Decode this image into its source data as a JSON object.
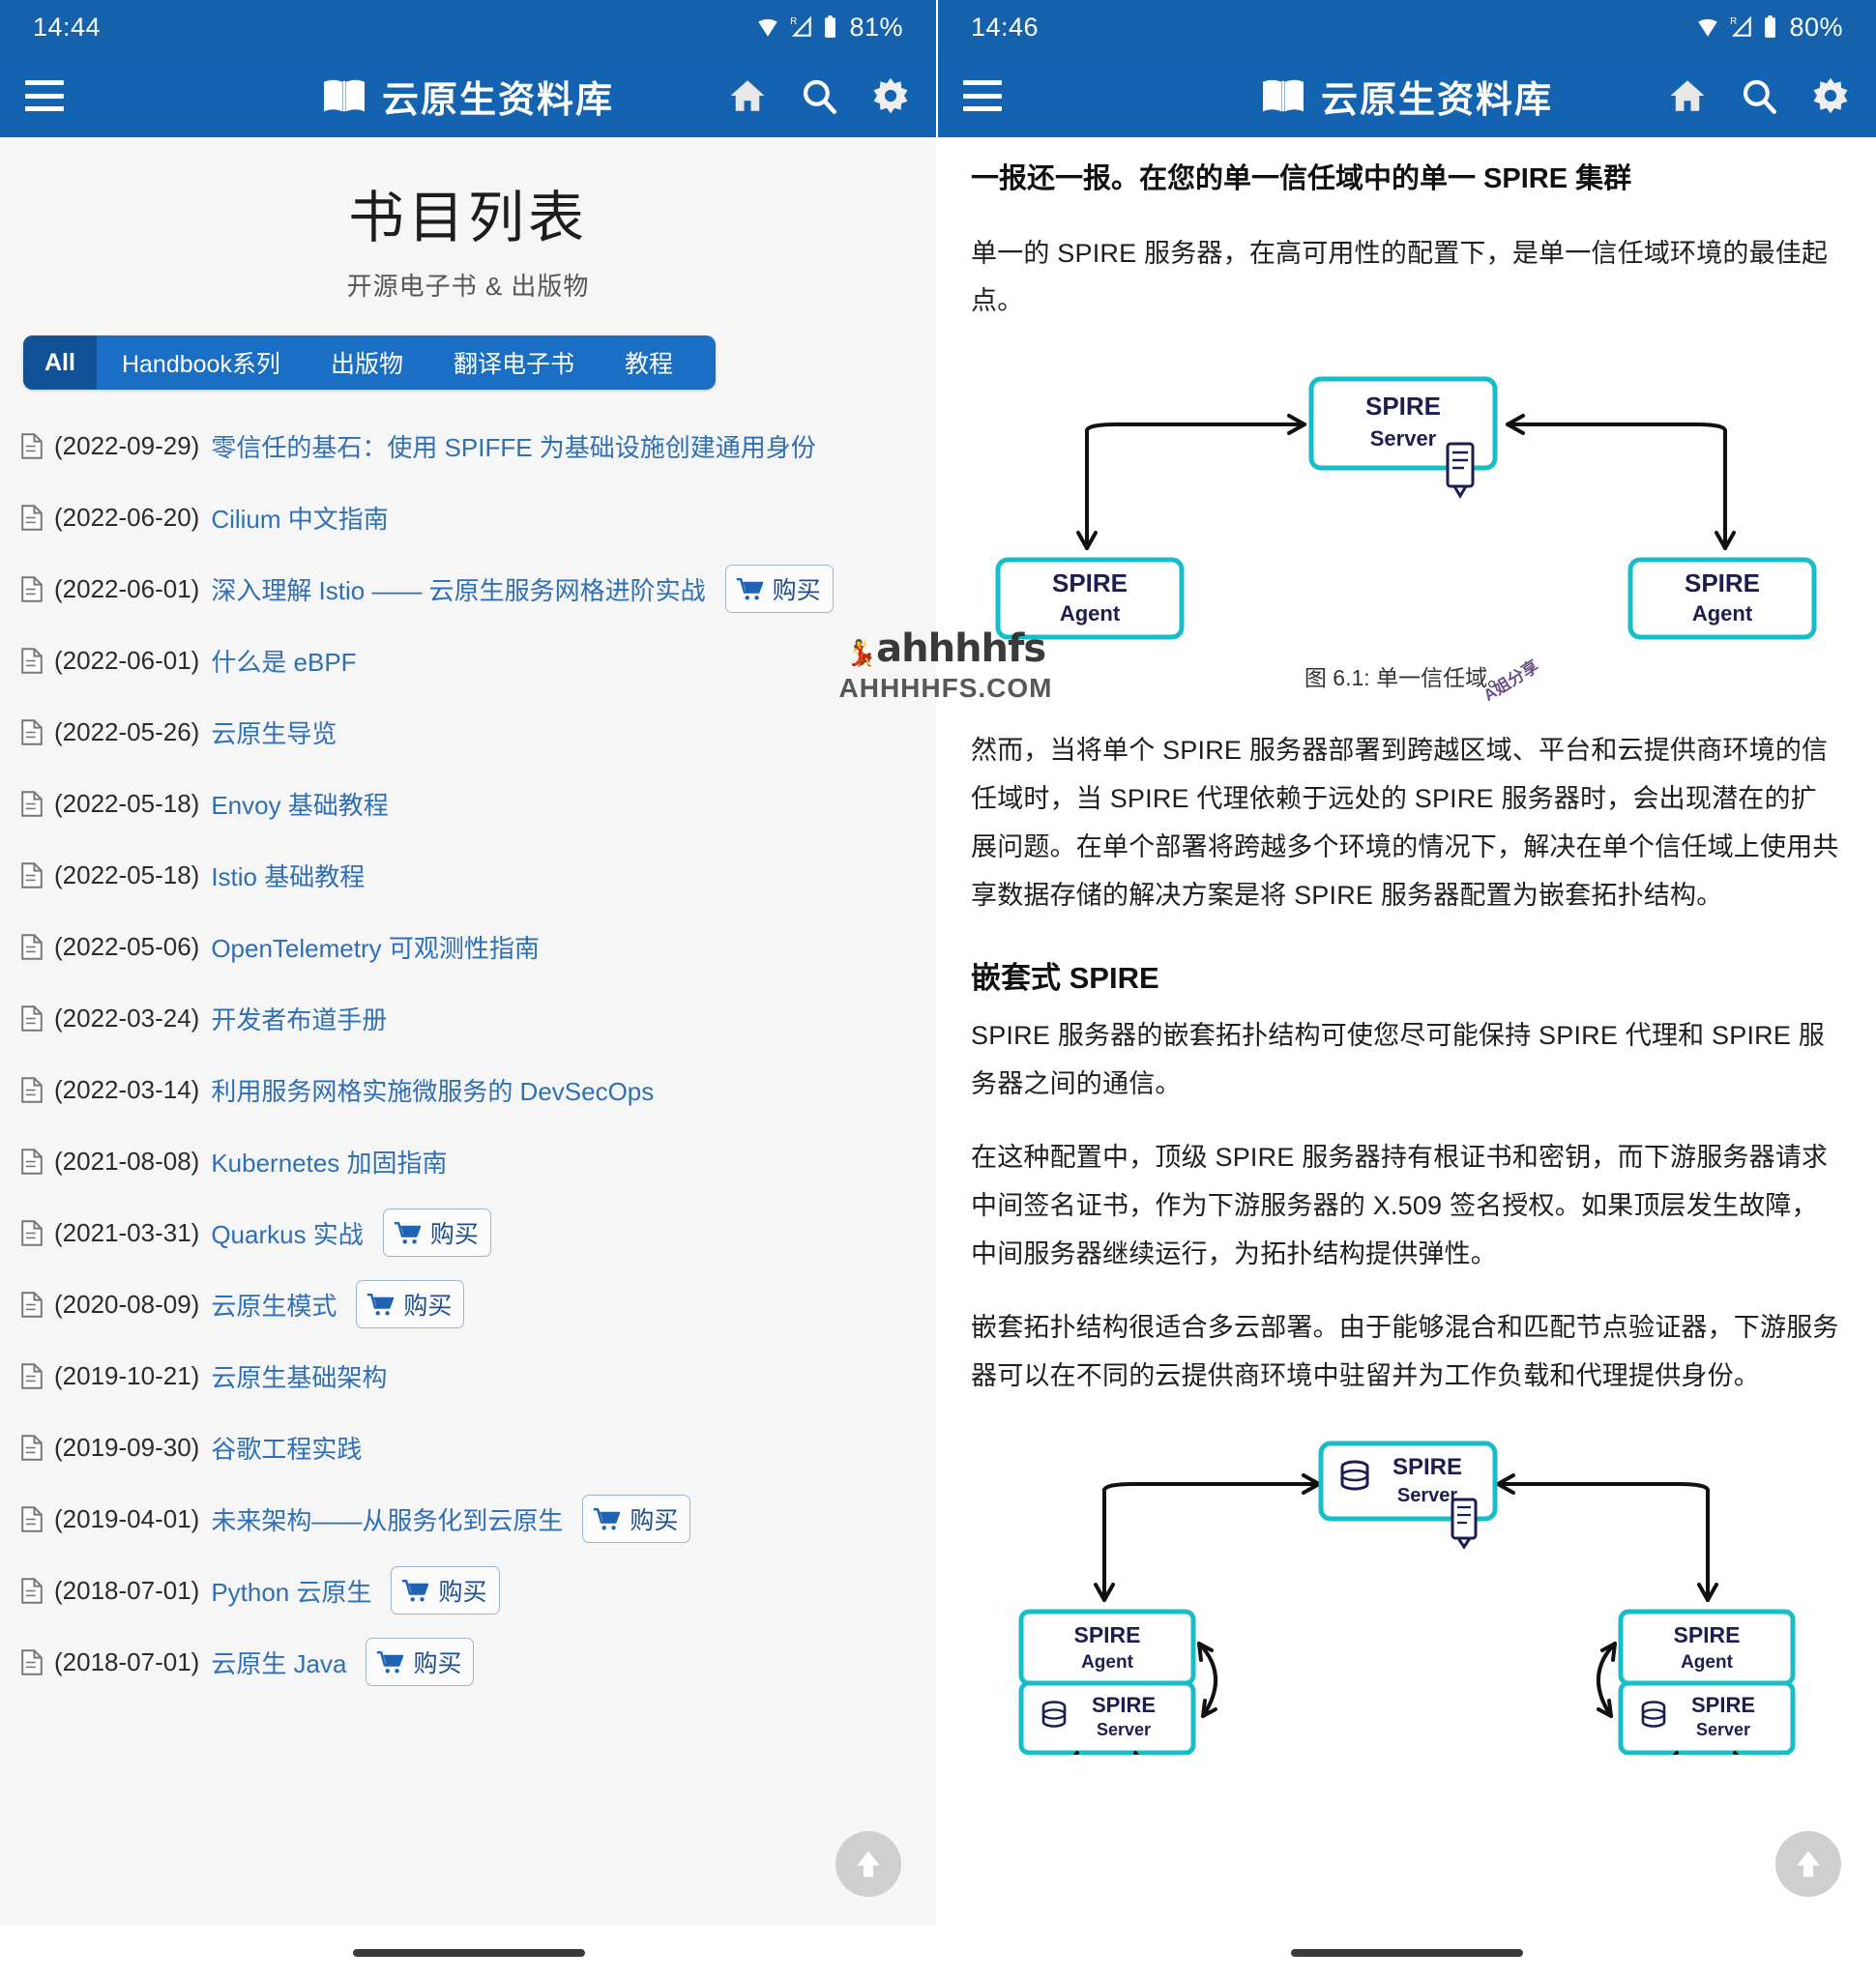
{
  "left_screen": {
    "statusbar": {
      "time": "14:44",
      "battery": "81%",
      "wifi_icon": "wifi-icon",
      "signal_icon": "signal-roaming-icon",
      "battery_icon": "battery-icon"
    },
    "appbar": {
      "menu_icon": "hamburger-menu-icon",
      "logo_icon": "open-book-icon",
      "title": "云原生资料库",
      "actions": [
        {
          "name": "home-icon",
          "label": "首页"
        },
        {
          "name": "search-icon",
          "label": "搜索"
        },
        {
          "name": "gear-icon",
          "label": "设置"
        }
      ]
    },
    "page": {
      "title": "书目列表",
      "subtitle": "开源电子书 & 出版物",
      "tabs": [
        {
          "label": "All",
          "active": true
        },
        {
          "label": "Handbook系列",
          "active": false
        },
        {
          "label": "出版物",
          "active": false
        },
        {
          "label": "翻译电子书",
          "active": false
        },
        {
          "label": "教程",
          "active": false
        }
      ],
      "buy_label": "购买",
      "books": [
        {
          "date": "(2022-09-29)",
          "name": "零信任的基石：使用 SPIFFE 为基础设施创建通用身份",
          "buy": false
        },
        {
          "date": "(2022-06-20)",
          "name": "Cilium 中文指南",
          "buy": false
        },
        {
          "date": "(2022-06-01)",
          "name": "深入理解 Istio —— 云原生服务网格进阶实战",
          "buy": true
        },
        {
          "date": "(2022-06-01)",
          "name": "什么是 eBPF",
          "buy": false
        },
        {
          "date": "(2022-05-26)",
          "name": "云原生导览",
          "buy": false
        },
        {
          "date": "(2022-05-18)",
          "name": "Envoy 基础教程",
          "buy": false
        },
        {
          "date": "(2022-05-18)",
          "name": "Istio 基础教程",
          "buy": false
        },
        {
          "date": "(2022-05-06)",
          "name": "OpenTelemetry 可观测性指南",
          "buy": false
        },
        {
          "date": "(2022-03-24)",
          "name": "开发者布道手册",
          "buy": false
        },
        {
          "date": "(2022-03-14)",
          "name": "利用服务网格实施微服务的 DevSecOps",
          "buy": false
        },
        {
          "date": "(2021-08-08)",
          "name": "Kubernetes 加固指南",
          "buy": false
        },
        {
          "date": "(2021-03-31)",
          "name": "Quarkus 实战",
          "buy": true
        },
        {
          "date": "(2020-08-09)",
          "name": "云原生模式",
          "buy": true
        },
        {
          "date": "(2019-10-21)",
          "name": "云原生基础架构",
          "buy": false
        },
        {
          "date": "(2019-09-30)",
          "name": "谷歌工程实践",
          "buy": false
        },
        {
          "date": "(2019-04-01)",
          "name": "未来架构——从服务化到云原生",
          "buy": true
        },
        {
          "date": "(2018-07-01)",
          "name": "Python 云原生",
          "buy": true
        },
        {
          "date": "(2018-07-01)",
          "name": "云原生 Java",
          "buy": true
        }
      ]
    },
    "fab": {
      "name": "scroll-to-top-button",
      "icon": "arrow-up-icon"
    }
  },
  "right_screen": {
    "statusbar": {
      "time": "14:46",
      "battery": "80%",
      "wifi_icon": "wifi-icon",
      "signal_icon": "signal-roaming-icon",
      "battery_icon": "battery-icon"
    },
    "appbar": {
      "menu_icon": "hamburger-menu-icon",
      "logo_icon": "open-book-icon",
      "title": "云原生资料库",
      "actions": [
        {
          "name": "home-icon",
          "label": "首页"
        },
        {
          "name": "search-icon",
          "label": "搜索"
        },
        {
          "name": "gear-icon",
          "label": "设置"
        }
      ]
    },
    "content": {
      "heading": "一报还一报。在您的单一信任域中的单一 SPIRE 集群",
      "para1": "单一的 SPIRE 服务器，在高可用性的配置下，是单一信任域环境的最佳起点。",
      "figure1_caption": "图 6.1: 单一信任域。",
      "para2": "然而，当将单个 SPIRE 服务器部署到跨越区域、平台和云提供商环境的信任域时，当 SPIRE 代理依赖于远处的 SPIRE 服务器时，会出现潜在的扩展问题。在单个部署将跨越多个环境的情况下，解决在单个信任域上使用共享数据存储的解决方案是将 SPIRE 服务器配置为嵌套拓扑结构。",
      "heading2": "嵌套式 SPIRE",
      "para3": "SPIRE 服务器的嵌套拓扑结构可使您尽可能保持 SPIRE 代理和 SPIRE 服务器之间的通信。",
      "para4": "在这种配置中，顶级 SPIRE 服务器持有根证书和密钥，而下游服务器请求中间签名证书，作为下游服务器的 X.509 签名授权。如果顶层发生故障，中间服务器继续运行，为拓扑结构提供弹性。",
      "para5": "嵌套拓扑结构很适合多云部署。由于能够混合和匹配节点验证器，下游服务器可以在不同的云提供商环境中驻留并为工作负载和代理提供身份。"
    },
    "diagram1": {
      "nodes": [
        {
          "title": "SPIRE",
          "subtitle": "Server",
          "has_db_icon": false,
          "has_cert_icon": true
        },
        {
          "title": "SPIRE",
          "subtitle": "Agent",
          "has_db_icon": false,
          "has_cert_icon": false
        },
        {
          "title": "SPIRE",
          "subtitle": "Agent",
          "has_db_icon": false,
          "has_cert_icon": false
        }
      ]
    },
    "diagram2": {
      "nodes": [
        {
          "title": "SPIRE",
          "subtitle": "Server",
          "has_db_icon": true,
          "has_cert_icon": true
        },
        {
          "title": "SPIRE",
          "subtitle": "Agent",
          "has_db_icon": false,
          "has_cert_icon": false
        },
        {
          "title": "SPIRE",
          "subtitle": "Server",
          "has_db_icon": true,
          "has_cert_icon": false
        },
        {
          "title": "SPIRE",
          "subtitle": "Agent",
          "has_db_icon": false,
          "has_cert_icon": false
        },
        {
          "title": "SPIRE",
          "subtitle": "Server",
          "has_db_icon": true,
          "has_cert_icon": false
        }
      ]
    },
    "fab": {
      "name": "scroll-to-top-button",
      "icon": "arrow-up-icon"
    }
  },
  "watermark": {
    "top": "ahhhhfs",
    "bottom": "AHHHHFS.COM",
    "diagonal": "A姐分享"
  },
  "colors": {
    "appbar_blue": "#1363b0",
    "status_blue": "#1661ab",
    "tab_blue": "#1a6fc4",
    "tab_active_blue": "#105295",
    "link_blue": "#2f6fb5",
    "diagram_teal": "#18bec7",
    "diagram_navy": "#1d1d52"
  }
}
